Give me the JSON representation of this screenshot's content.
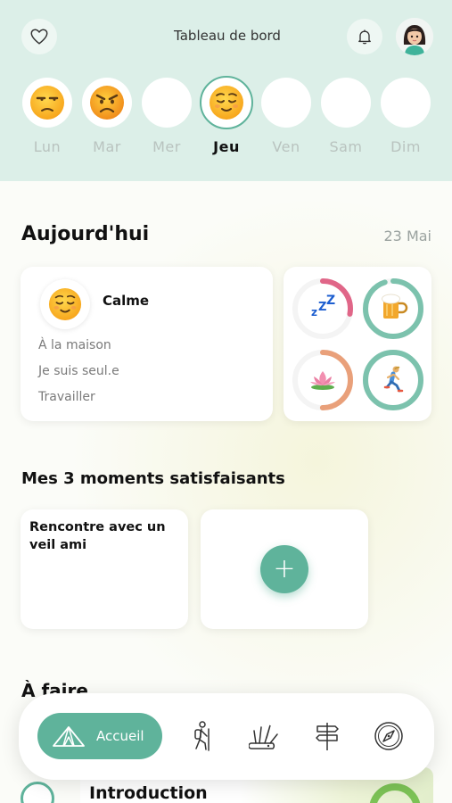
{
  "header": {
    "title": "Tableau de bord",
    "days": [
      {
        "label": "Lun",
        "mood": "unamused-face"
      },
      {
        "label": "Mar",
        "mood": "angry-face"
      },
      {
        "label": "Mer",
        "mood": ""
      },
      {
        "label": "Jeu",
        "mood": "relieved-face",
        "active": true
      },
      {
        "label": "Ven",
        "mood": ""
      },
      {
        "label": "Sam",
        "mood": ""
      },
      {
        "label": "Dim",
        "mood": ""
      }
    ]
  },
  "today": {
    "title": "Aujourd'hui",
    "date": "23 Mai",
    "mood": {
      "name": "Calme",
      "lines": [
        "À la maison",
        "Je suis seul.e",
        "Travailler"
      ]
    },
    "stats": [
      {
        "icon": "sleep-icon",
        "level": 0.28,
        "color": "#e06688"
      },
      {
        "icon": "beer-icon",
        "level": 0.95,
        "color": "#7cc2ad"
      },
      {
        "icon": "lotus-icon",
        "level": 0.5,
        "color": "#e9a07a"
      },
      {
        "icon": "runner-icon",
        "level": 1.0,
        "color": "#7cc2ad"
      }
    ]
  },
  "moments": {
    "title": "Mes 3 moments satisfaisants",
    "items": [
      "Rencontre avec un veil ami"
    ],
    "add_label": "+"
  },
  "todo": {
    "title": "À faire",
    "peek_label": "Introduction"
  },
  "nav": {
    "home_label": "Accueil",
    "icons": [
      "tent-icon",
      "hiker-icon",
      "swiss-knife-icon",
      "signpost-icon",
      "compass-icon"
    ]
  },
  "colors": {
    "accent": "#5fb39b",
    "header_bg": "#dcefe8"
  }
}
